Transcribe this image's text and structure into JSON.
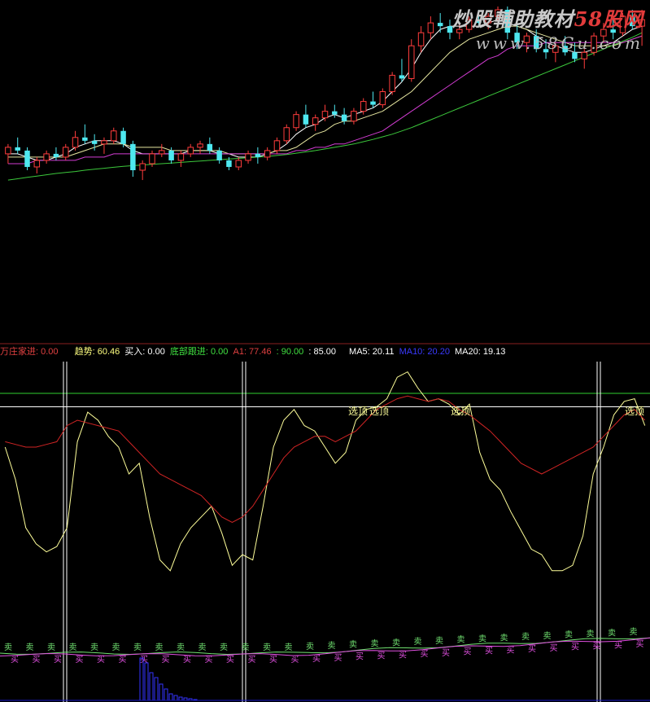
{
  "watermark": {
    "cn_prefix": "炒股輔助教材",
    "cn_highlight": "58股网",
    "url": "www.58Gu.com"
  },
  "indicator_bar": {
    "item1": "万庄家进: 0.00",
    "item2": "趋势: 60.46",
    "item3": "买入: 0.00",
    "item4": "底部跟进: 0.00",
    "item5": "A1: 77.46",
    "item6": ": 90.00",
    "item7": ": 85.00",
    "item8": "MA5: 20.11",
    "item9": "MA10: 20.20",
    "item10": "MA20: 19.13"
  },
  "colors": {
    "background": "#000000",
    "up_candle": "#ff3c3c",
    "down_candle": "#4ee8f0",
    "ma_fast": "#ffffff",
    "ma_mid": "#e6e6a0",
    "ma_slow": "#d23cd2",
    "ma_long": "#3cc83c",
    "trend_line": "#ffff9a",
    "follow_line": "#d02424",
    "buy_label": "#e050e0",
    "sell_label": "#70e070",
    "volume": "#3333ff"
  },
  "chart_data": [
    {
      "type": "candlestick",
      "title": "",
      "ylim": [
        0,
        100
      ],
      "ohlc": [
        [
          55,
          58,
          52,
          57
        ],
        [
          57,
          60,
          55,
          56
        ],
        [
          56,
          57,
          50,
          51
        ],
        [
          51,
          54,
          49,
          53
        ],
        [
          53,
          56,
          52,
          55
        ],
        [
          55,
          57,
          53,
          54
        ],
        [
          54,
          58,
          53,
          57
        ],
        [
          57,
          62,
          56,
          60
        ],
        [
          60,
          64,
          58,
          59
        ],
        [
          59,
          61,
          56,
          58
        ],
        [
          58,
          60,
          55,
          59
        ],
        [
          59,
          63,
          58,
          62
        ],
        [
          62,
          63,
          57,
          58
        ],
        [
          58,
          59,
          48,
          50
        ],
        [
          50,
          53,
          47,
          52
        ],
        [
          52,
          56,
          51,
          55
        ],
        [
          55,
          58,
          54,
          56
        ],
        [
          56,
          57,
          52,
          53
        ],
        [
          53,
          56,
          51,
          55
        ],
        [
          55,
          58,
          54,
          57
        ],
        [
          57,
          59,
          55,
          58
        ],
        [
          58,
          60,
          55,
          56
        ],
        [
          56,
          57,
          52,
          53
        ],
        [
          53,
          54,
          50,
          51
        ],
        [
          51,
          54,
          50,
          53
        ],
        [
          53,
          56,
          52,
          55
        ],
        [
          55,
          57,
          52,
          54
        ],
        [
          54,
          57,
          53,
          56
        ],
        [
          56,
          60,
          55,
          59
        ],
        [
          59,
          64,
          58,
          63
        ],
        [
          63,
          68,
          62,
          67
        ],
        [
          67,
          70,
          63,
          64
        ],
        [
          64,
          67,
          62,
          66
        ],
        [
          66,
          70,
          65,
          68
        ],
        [
          68,
          70,
          66,
          67
        ],
        [
          67,
          69,
          64,
          65
        ],
        [
          65,
          69,
          64,
          68
        ],
        [
          68,
          72,
          67,
          71
        ],
        [
          71,
          74,
          69,
          70
        ],
        [
          70,
          75,
          69,
          74
        ],
        [
          74,
          80,
          73,
          79
        ],
        [
          79,
          84,
          77,
          78
        ],
        [
          78,
          90,
          77,
          88
        ],
        [
          88,
          94,
          86,
          92
        ],
        [
          92,
          97,
          90,
          95
        ],
        [
          95,
          98,
          92,
          94
        ],
        [
          94,
          96,
          90,
          92
        ],
        [
          92,
          95,
          90,
          93
        ],
        [
          93,
          97,
          92,
          96
        ],
        [
          96,
          99,
          94,
          95
        ],
        [
          95,
          98,
          93,
          97
        ],
        [
          97,
          100,
          95,
          99
        ],
        [
          99,
          100,
          90,
          92
        ],
        [
          92,
          95,
          87,
          89
        ],
        [
          89,
          92,
          86,
          91
        ],
        [
          91,
          93,
          86,
          87
        ],
        [
          87,
          90,
          84,
          86
        ],
        [
          86,
          89,
          83,
          88
        ],
        [
          88,
          91,
          85,
          86
        ],
        [
          86,
          89,
          83,
          84
        ],
        [
          84,
          87,
          81,
          86
        ],
        [
          86,
          92,
          85,
          91
        ],
        [
          91,
          95,
          89,
          93
        ],
        [
          93,
          96,
          90,
          92
        ],
        [
          92,
          98,
          91,
          97
        ],
        [
          97,
          99,
          93,
          94
        ],
        [
          94,
          99,
          88,
          96
        ]
      ],
      "series": [
        {
          "values": [
            55,
            55,
            54,
            53,
            53,
            54,
            55,
            57,
            58,
            59,
            59,
            59,
            58,
            56,
            55,
            55,
            55,
            55,
            55,
            56,
            56,
            56,
            55,
            55,
            54,
            54,
            54,
            55,
            56,
            58,
            61,
            63,
            64,
            66,
            67,
            66,
            67,
            68,
            69,
            71,
            74,
            77,
            81,
            86,
            90,
            93,
            94,
            94,
            94,
            94,
            95,
            96,
            95,
            94,
            93,
            91,
            89,
            88,
            87,
            86,
            86,
            87,
            88,
            89,
            91,
            93,
            94
          ]
        },
        {
          "values": [
            54,
            54,
            54,
            54,
            54,
            54,
            54,
            55,
            56,
            57,
            58,
            58,
            58,
            57,
            57,
            57,
            57,
            56,
            56,
            56,
            56,
            56,
            56,
            55,
            55,
            55,
            55,
            55,
            56,
            56,
            57,
            59,
            61,
            62,
            64,
            65,
            65,
            66,
            67,
            68,
            70,
            72,
            74,
            77,
            80,
            83,
            86,
            88,
            90,
            91,
            92,
            93,
            94,
            94,
            93,
            92,
            91,
            90,
            89,
            88,
            88,
            88,
            88,
            88,
            89,
            90,
            91
          ]
        },
        {
          "values": [
            52,
            52,
            52,
            53,
            53,
            53,
            53,
            53,
            54,
            54,
            54,
            55,
            55,
            55,
            55,
            55,
            55,
            55,
            55,
            55,
            55,
            55,
            55,
            55,
            55,
            55,
            55,
            55,
            55,
            55,
            56,
            56,
            57,
            57,
            58,
            58,
            59,
            60,
            61,
            62,
            64,
            66,
            68,
            70,
            72,
            74,
            76,
            78,
            80,
            82,
            84,
            85,
            87,
            88,
            88,
            88,
            89,
            89,
            89,
            89,
            89,
            89,
            89,
            89,
            89,
            90,
            91
          ]
        },
        {
          "values": [
            47,
            47.4,
            47.8,
            48.2,
            48.6,
            49,
            49.3,
            49.6,
            50,
            50.3,
            50.6,
            50.9,
            51.2,
            51.4,
            51.6,
            51.8,
            52,
            52.2,
            52.4,
            52.6,
            52.8,
            53,
            53.2,
            53.4,
            53.6,
            53.8,
            54,
            54.2,
            54.5,
            54.8,
            55.2,
            55.6,
            56,
            56.5,
            57,
            57.5,
            58,
            58.7,
            59.4,
            60.2,
            61,
            62,
            63,
            64.2,
            65.4,
            66.6,
            67.8,
            69,
            70.2,
            71.4,
            72.6,
            73.8,
            75,
            76.2,
            77.4,
            78.6,
            79.8,
            81,
            82.2,
            83.4,
            84.6,
            85.8,
            87,
            88.2,
            89.4,
            90.6,
            92
          ]
        }
      ]
    },
    {
      "type": "line",
      "title": "",
      "ylim": [
        0,
        100
      ],
      "hlines": [
        90,
        85
      ],
      "top_label": "选顶",
      "buy_label": "买",
      "sell_label": "卖",
      "series": [
        {
          "values": [
            70,
            58,
            40,
            34,
            31,
            33,
            40,
            72,
            83,
            80,
            74,
            70,
            60,
            64,
            44,
            28,
            24,
            34,
            40,
            44,
            48,
            38,
            26,
            30,
            28,
            48,
            70,
            80,
            84,
            78,
            76,
            70,
            64,
            68,
            80,
            84,
            85,
            88,
            96,
            98,
            92,
            87,
            88,
            86,
            82,
            86,
            68,
            58,
            54,
            46,
            39,
            32,
            30,
            24,
            24,
            26,
            37,
            60,
            70,
            82,
            87,
            88,
            78
          ]
        },
        {
          "values": [
            72,
            71,
            70,
            70,
            71,
            72,
            78,
            80,
            79,
            78,
            77,
            76,
            72,
            68,
            64,
            60,
            58,
            56,
            54,
            52,
            48,
            44,
            42,
            44,
            48,
            54,
            60,
            66,
            70,
            72,
            74,
            74,
            72,
            74,
            76,
            80,
            84,
            86,
            88,
            89,
            88,
            87,
            88,
            87,
            84,
            82,
            79,
            76,
            72,
            68,
            64,
            62,
            60,
            62,
            64,
            66,
            68,
            70,
            74,
            78,
            82,
            84,
            80
          ]
        },
        {
          "values": [
            0,
            0,
            0,
            0,
            0,
            0,
            0,
            0,
            0,
            0,
            0,
            0,
            0,
            0,
            0,
            0,
            0,
            0,
            0,
            0,
            0,
            0,
            0,
            0,
            0,
            0,
            0,
            0,
            0,
            0,
            0,
            0,
            0,
            0,
            0,
            0,
            0,
            0,
            0,
            0,
            0,
            0,
            0,
            0,
            0,
            0,
            0,
            0,
            0,
            0,
            0,
            0,
            0,
            0,
            0,
            0,
            0,
            0,
            0,
            0,
            0,
            0,
            0
          ]
        }
      ]
    }
  ]
}
